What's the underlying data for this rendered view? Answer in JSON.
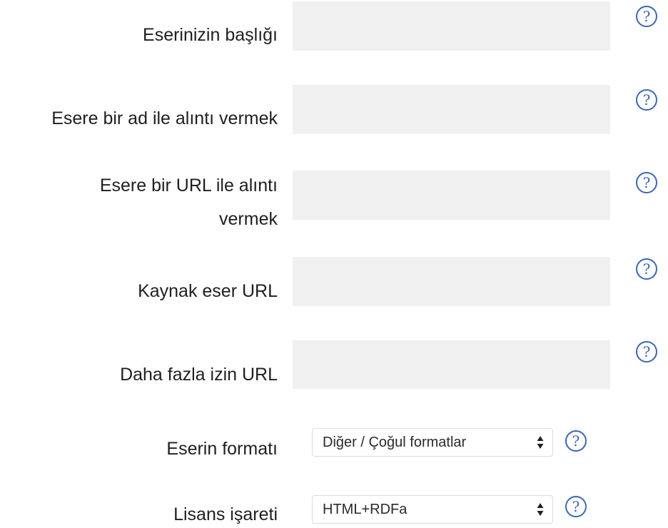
{
  "form": {
    "title": {
      "label": "Eserinizin başlığı",
      "value": "",
      "help": "?"
    },
    "attribution_name": {
      "label": "Esere bir ad ile alıntı vermek",
      "value": "",
      "help": "?"
    },
    "attribution_url": {
      "label_line1": "Esere bir URL ile alıntı",
      "label_line2": "vermek",
      "value": "",
      "help": "?"
    },
    "source_url": {
      "label": "Kaynak eser URL",
      "value": "",
      "help": "?"
    },
    "more_permissions_url": {
      "label": "Daha fazla izin URL",
      "value": "",
      "help": "?"
    },
    "format": {
      "label": "Eserin formatı",
      "selected": "Diğer / Çoğul formatlar",
      "help": "?"
    },
    "license_mark": {
      "label": "Lisans işareti",
      "selected": "HTML+RDFa",
      "help": "?"
    }
  },
  "colors": {
    "field_bg": "#f0f0f0",
    "help_icon": "#3a67b8",
    "label_text": "#1f1f1f"
  },
  "icons": {
    "help": "question-circle-icon",
    "select_arrows": "up-down-arrows-icon"
  }
}
